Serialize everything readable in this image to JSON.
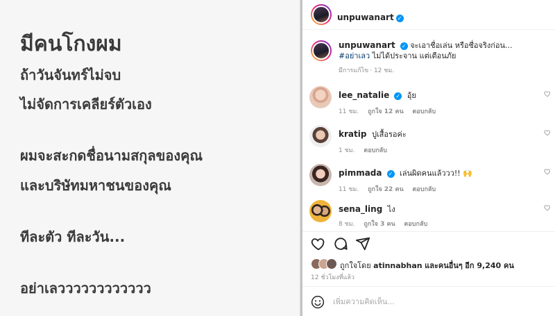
{
  "post_image": {
    "lines": [
      "มีคนโกงผม",
      "ถ้าวันจันทร์ไม่จบ",
      "ไม่จัดการเคลียร์ตัวเอง",
      "ผมจะสะกดชื่อนามสกุลของคุณ",
      "และบริษัทมหาชนของคุณ",
      "ทีละตัว ทีละวัน...",
      "อย่าเลวววววววววววว"
    ]
  },
  "header": {
    "username": "unpuwanart",
    "verified": true
  },
  "caption": {
    "username": "unpuwanart",
    "text": "จะเอาชื่อเล่น หรือชื่อจริงก่อน...",
    "hashtag": "#อย่าเลว",
    "text2": "ไม่ได้ประจาน แต่เตือนภัย",
    "edited": "มีการแก้ไข",
    "time": "12 ชม."
  },
  "comments": [
    {
      "username": "lee_natalie",
      "verified": true,
      "text": "อุ้ย",
      "time": "11 ชม.",
      "likes": "ถูกใจ 12 คน",
      "reply": "ตอบกลับ"
    },
    {
      "username": "kratip",
      "verified": false,
      "text": "ปูเสื้อรอค่ะ",
      "time": "1 ชม.",
      "likes": "",
      "reply": "ตอบกลับ"
    },
    {
      "username": "pimmada",
      "verified": true,
      "text": "เล่นผิดคนแล้ววว!! 🙌",
      "time": "11 ชม.",
      "likes": "ถูกใจ 22 คน",
      "reply": "ตอบกลับ"
    },
    {
      "username": "sena_ling",
      "verified": false,
      "text": "ไง",
      "time": "8 ชม.",
      "likes": "ถูกใจ 3 คน",
      "reply": "ตอบกลับ"
    }
  ],
  "actions": {
    "like_icon": "heart-icon",
    "comment_icon": "comment-icon",
    "share_icon": "share-icon"
  },
  "likes": {
    "prefix": "ถูกใจโดย",
    "user": "atinnabhan",
    "middle": "และคนอื่นๆ",
    "count": "อีก 9,240 คน"
  },
  "timeago": "12 ชั่วโมงที่แล้ว",
  "compose": {
    "placeholder": "เพิ่มความคิดเห็น..."
  },
  "colors": {
    "accent": "#0095f6",
    "muted": "#8e8e8e",
    "hashtag": "#00376b",
    "image_bg": "#f6f6f6"
  }
}
